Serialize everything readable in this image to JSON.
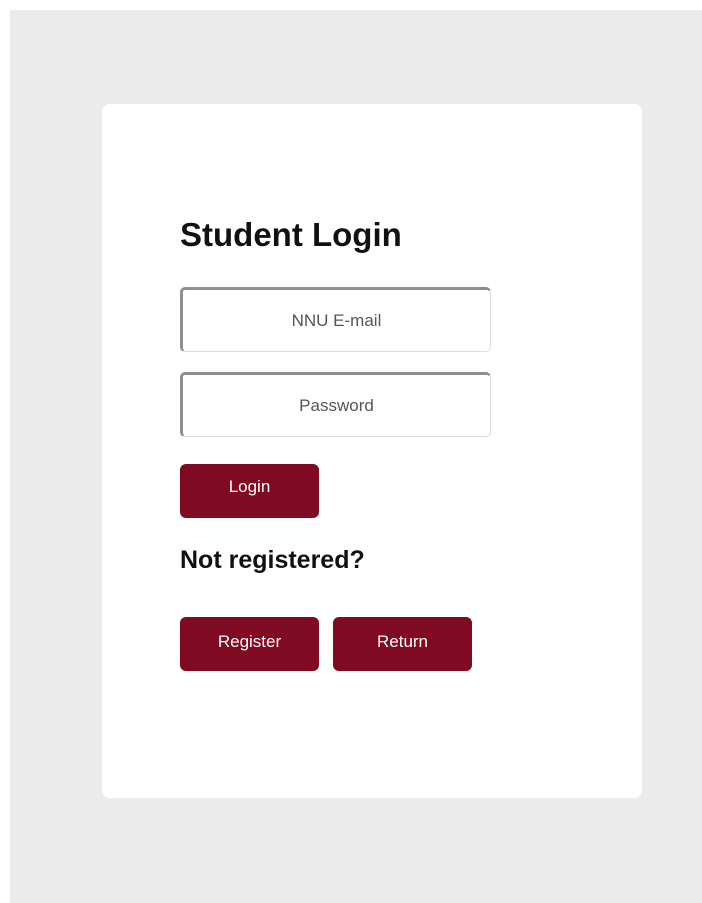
{
  "login_form": {
    "title": "Student Login",
    "email_field": {
      "placeholder": "NNU E-mail",
      "value": ""
    },
    "password_field": {
      "placeholder": "Password",
      "value": ""
    },
    "login_button_label": "Login",
    "register_prompt": "Not registered?",
    "register_button_label": "Register",
    "return_button_label": "Return"
  },
  "colors": {
    "page_background": "#ebebeb",
    "card_background": "#ffffff",
    "button_background": "#7f0a22",
    "button_text": "#ffffff"
  }
}
